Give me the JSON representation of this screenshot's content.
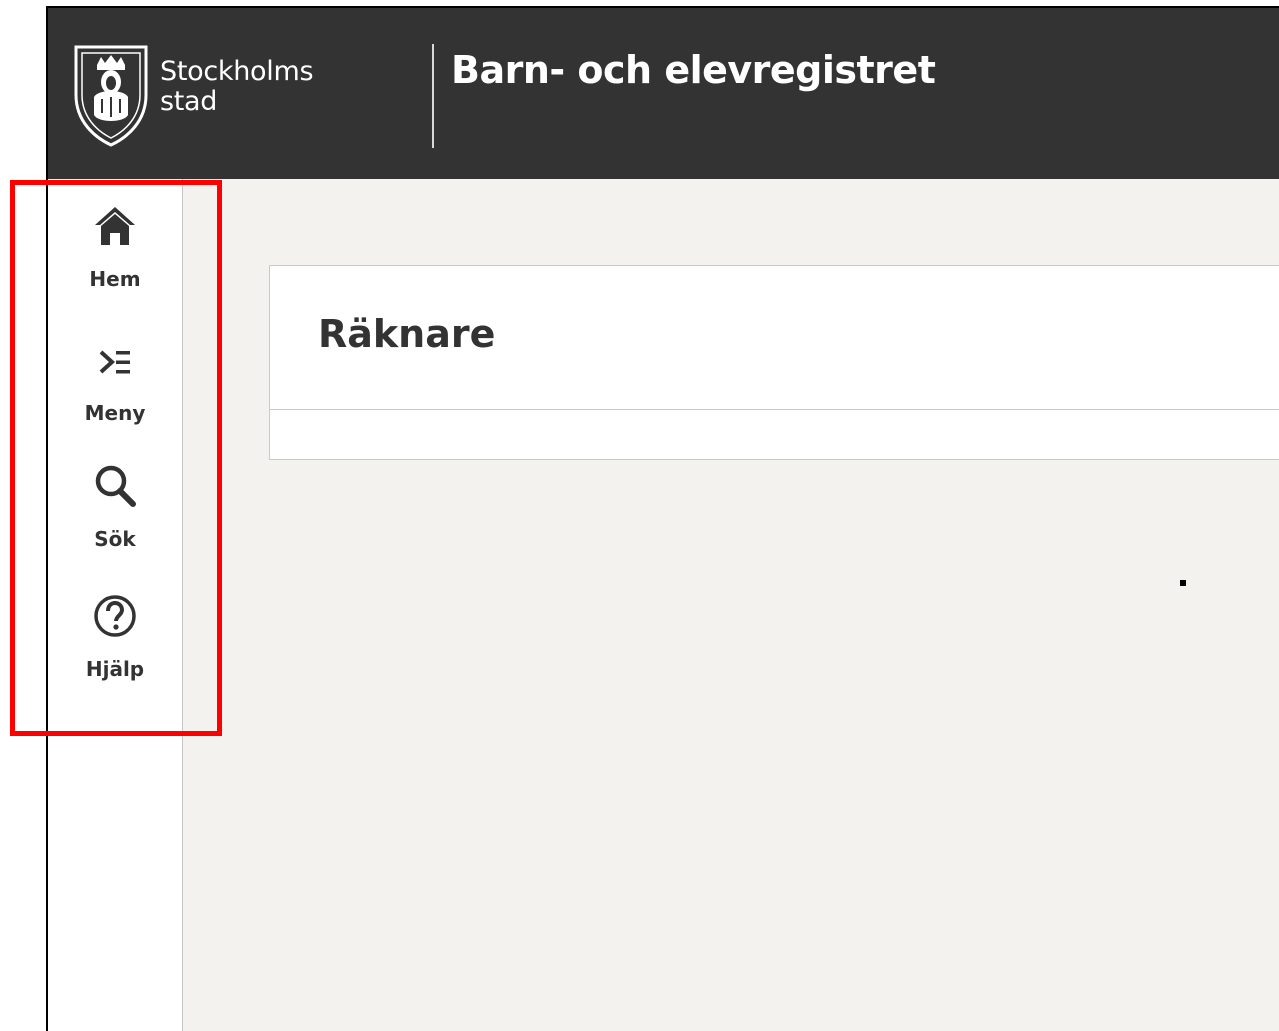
{
  "header": {
    "logo_text_line1": "Stockholms",
    "logo_text_line2": "stad",
    "app_title": "Barn- och elevregistret"
  },
  "sidebar": {
    "items": [
      {
        "label": "Hem",
        "icon": "home-icon"
      },
      {
        "label": "Meny",
        "icon": "menu-icon"
      },
      {
        "label": "Sök",
        "icon": "search-icon"
      },
      {
        "label": "Hjälp",
        "icon": "help-icon"
      }
    ]
  },
  "main": {
    "card_title": "Räknare"
  },
  "colors": {
    "header_bg": "#333333",
    "page_bg": "#f3f2ee",
    "highlight": "#ff0000",
    "text": "#333333"
  }
}
